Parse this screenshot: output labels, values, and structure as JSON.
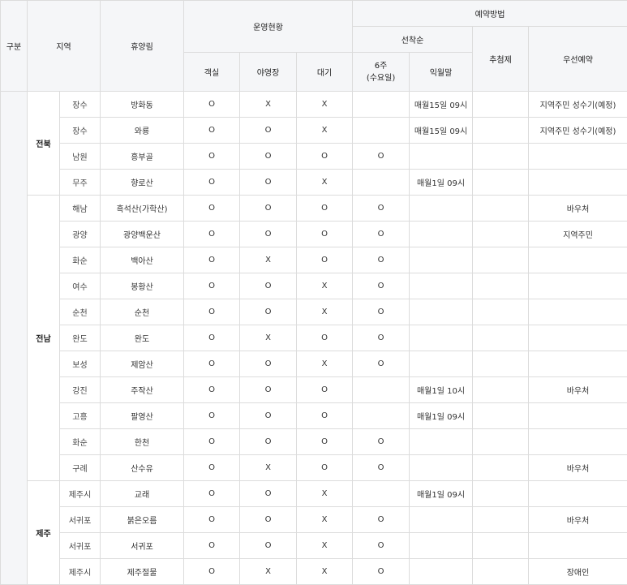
{
  "header": {
    "gubun": "구분",
    "region": "지역",
    "forest": "휴양림",
    "operation": "운영현황",
    "reservation": "예약방법",
    "first_come": "선착순",
    "lottery": "추첨제",
    "priority": "우선예약",
    "room": "객실",
    "camping": "야영장",
    "standby": "대기",
    "six_weeks_line1": "6주",
    "six_weeks_line2": "(수요일)",
    "next_month_end": "익월말"
  },
  "groups": [
    {
      "region": "전북",
      "rows": [
        {
          "city": "장수",
          "forest": "방화동",
          "room": "O",
          "camp": "X",
          "wait": "X",
          "six": "",
          "next": "매월15일 09시",
          "lottery": "",
          "priority": "지역주민 성수기(예정)"
        },
        {
          "city": "장수",
          "forest": "와룡",
          "room": "O",
          "camp": "O",
          "wait": "X",
          "six": "",
          "next": "매월15일 09시",
          "lottery": "",
          "priority": "지역주민 성수기(예정)"
        },
        {
          "city": "남원",
          "forest": "흥부골",
          "room": "O",
          "camp": "O",
          "wait": "O",
          "six": "O",
          "next": "",
          "lottery": "",
          "priority": ""
        },
        {
          "city": "무주",
          "forest": "향로산",
          "room": "O",
          "camp": "O",
          "wait": "X",
          "six": "",
          "next": "매월1일 09시",
          "lottery": "",
          "priority": ""
        }
      ]
    },
    {
      "region": "전남",
      "rows": [
        {
          "city": "해남",
          "forest": "흑석산(가학산)",
          "room": "O",
          "camp": "O",
          "wait": "O",
          "six": "O",
          "next": "",
          "lottery": "",
          "priority": "바우처"
        },
        {
          "city": "광양",
          "forest": "광양백운산",
          "room": "O",
          "camp": "O",
          "wait": "O",
          "six": "O",
          "next": "",
          "lottery": "",
          "priority": "지역주민"
        },
        {
          "city": "화순",
          "forest": "백아산",
          "room": "O",
          "camp": "X",
          "wait": "O",
          "six": "O",
          "next": "",
          "lottery": "",
          "priority": ""
        },
        {
          "city": "여수",
          "forest": "봉황산",
          "room": "O",
          "camp": "O",
          "wait": "X",
          "six": "O",
          "next": "",
          "lottery": "",
          "priority": ""
        },
        {
          "city": "순천",
          "forest": "순천",
          "room": "O",
          "camp": "O",
          "wait": "X",
          "six": "O",
          "next": "",
          "lottery": "",
          "priority": ""
        },
        {
          "city": "완도",
          "forest": "완도",
          "room": "O",
          "camp": "X",
          "wait": "O",
          "six": "O",
          "next": "",
          "lottery": "",
          "priority": ""
        },
        {
          "city": "보성",
          "forest": "제암산",
          "room": "O",
          "camp": "O",
          "wait": "X",
          "six": "O",
          "next": "",
          "lottery": "",
          "priority": ""
        },
        {
          "city": "강진",
          "forest": "주작산",
          "room": "O",
          "camp": "O",
          "wait": "O",
          "six": "",
          "next": "매월1일 10시",
          "lottery": "",
          "priority": "바우처"
        },
        {
          "city": "고흥",
          "forest": "팔영산",
          "room": "O",
          "camp": "O",
          "wait": "O",
          "six": "",
          "next": "매월1일 09시",
          "lottery": "",
          "priority": ""
        },
        {
          "city": "화순",
          "forest": "한천",
          "room": "O",
          "camp": "O",
          "wait": "O",
          "six": "O",
          "next": "",
          "lottery": "",
          "priority": ""
        },
        {
          "city": "구례",
          "forest": "산수유",
          "room": "O",
          "camp": "X",
          "wait": "O",
          "six": "O",
          "next": "",
          "lottery": "",
          "priority": "바우처"
        }
      ]
    },
    {
      "region": "제주",
      "rows": [
        {
          "city": "제주시",
          "forest": "교래",
          "room": "O",
          "camp": "O",
          "wait": "X",
          "six": "",
          "next": "매월1일 09시",
          "lottery": "",
          "priority": ""
        },
        {
          "city": "서귀포",
          "forest": "붉은오름",
          "room": "O",
          "camp": "O",
          "wait": "X",
          "six": "O",
          "next": "",
          "lottery": "",
          "priority": "바우처"
        },
        {
          "city": "서귀포",
          "forest": "서귀포",
          "room": "O",
          "camp": "O",
          "wait": "X",
          "six": "O",
          "next": "",
          "lottery": "",
          "priority": ""
        },
        {
          "city": "제주시",
          "forest": "제주절물",
          "room": "O",
          "camp": "X",
          "wait": "X",
          "six": "O",
          "next": "",
          "lottery": "",
          "priority": "장애인"
        }
      ]
    }
  ]
}
